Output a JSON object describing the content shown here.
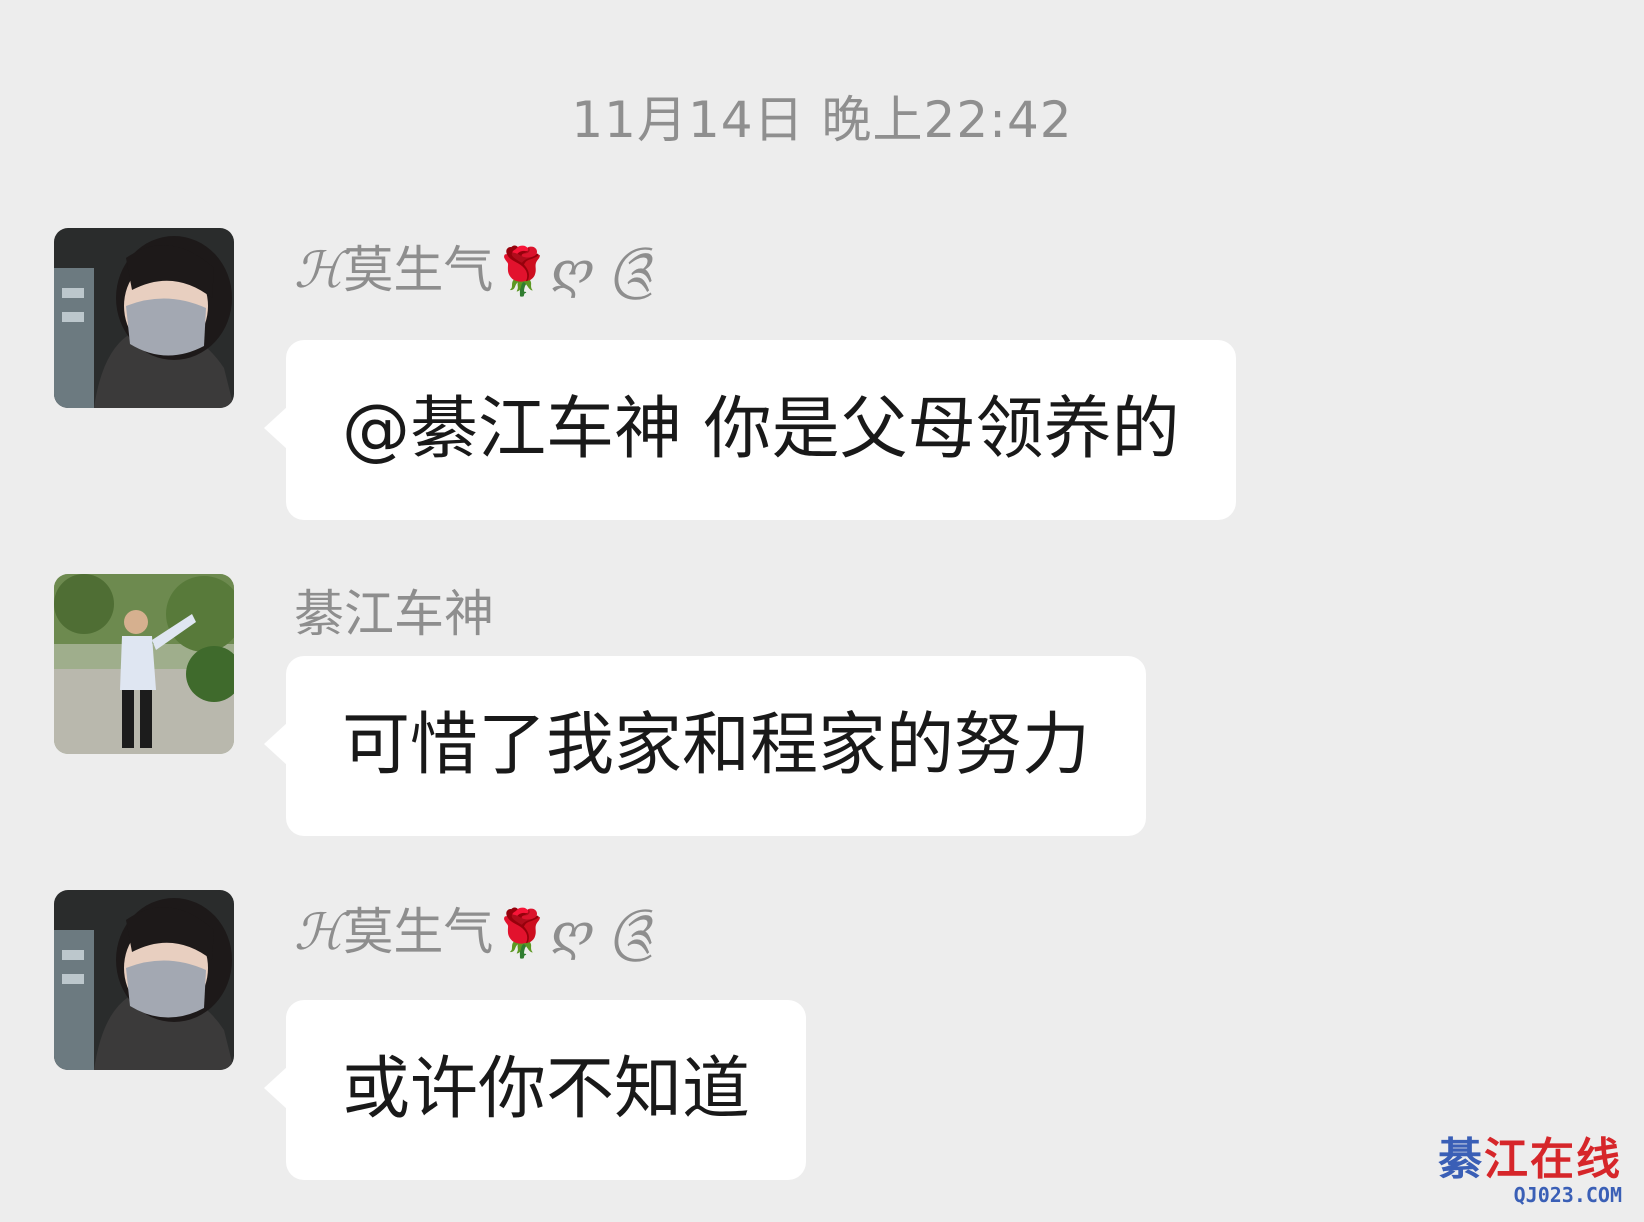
{
  "timestamp": "11月14日 晚上22:42",
  "messages": [
    {
      "sender_prefix": "ℋ",
      "sender_name": "莫生气",
      "sender_emoji": "🌹",
      "sender_suffix": "ღ ༊",
      "text": "@綦江车神  你是父母领养的"
    },
    {
      "sender_name": "綦江车神",
      "text": "可惜了我家和程家的努力"
    },
    {
      "sender_prefix": "ℋ",
      "sender_name": "莫生气",
      "sender_emoji": "🌹",
      "sender_suffix": "ღ ༊",
      "text": "或许你不知道"
    }
  ],
  "watermark": {
    "first_char": "綦",
    "rest": "江在线",
    "url": "QJ023.COM"
  }
}
